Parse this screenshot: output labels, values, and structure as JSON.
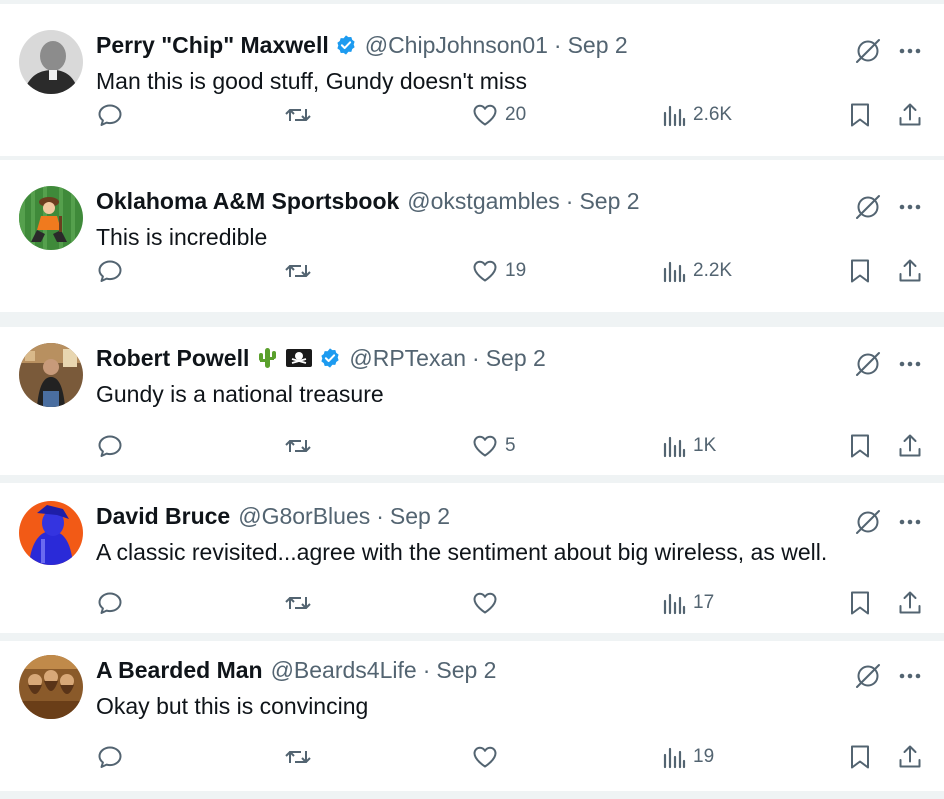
{
  "tweets": [
    {
      "name": "Perry \"Chip\" Maxwell",
      "verified": true,
      "emojis": [],
      "handle": "@ChipJohnson01",
      "separator": "·",
      "date": "Sep 2",
      "text": "Man this is good stuff, Gundy doesn't miss",
      "likes": "20",
      "views": "2.6K",
      "avatar_icon": "grayscale-portrait"
    },
    {
      "name": "Oklahoma A&M Sportsbook",
      "verified": false,
      "emojis": [],
      "handle": "@okstgambles",
      "separator": "·",
      "date": "Sep 2",
      "text": "This is incredible",
      "likes": "19",
      "views": "2.2K",
      "avatar_icon": "cowboy-mascot"
    },
    {
      "name": "Robert Powell",
      "verified": true,
      "emojis": [
        "cactus-icon",
        "pirate-flag-icon"
      ],
      "handle": "@RPTexan",
      "separator": "·",
      "date": "Sep 2",
      "text": "Gundy is a national treasure",
      "likes": "5",
      "views": "1K",
      "avatar_icon": "man-in-restaurant"
    },
    {
      "name": "David Bruce",
      "verified": false,
      "emojis": [],
      "handle": "@G8orBlues",
      "separator": "·",
      "date": "Sep 2",
      "text": "A classic revisited...agree with the sentiment about big wireless, as well.",
      "likes": "",
      "views": "17",
      "avatar_icon": "blue-silhouette-orange"
    },
    {
      "name": "A Bearded Man",
      "verified": false,
      "emojis": [],
      "handle": "@Beards4Life",
      "separator": "·",
      "date": "Sep 2",
      "text": "Okay but this is convincing",
      "likes": "",
      "views": "19",
      "avatar_icon": "bearded-band-photo"
    }
  ],
  "colors": {
    "background": "#eff3f4",
    "card": "#ffffff",
    "text": "#0f1419",
    "muted": "#536471",
    "verified": "#1d9bf0"
  }
}
